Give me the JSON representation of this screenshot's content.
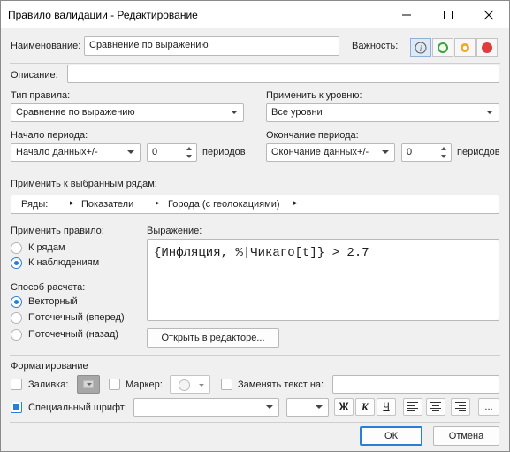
{
  "window": {
    "title": "Правило валидации - Редактирование"
  },
  "name": {
    "label": "Наименование:",
    "value": "Сравнение по выражению"
  },
  "severity": {
    "label": "Важность:",
    "levels": [
      "info-icon",
      "ring-green-icon",
      "ring-orange-icon",
      "dot-red-icon"
    ]
  },
  "description": {
    "label": "Описание:",
    "value": ""
  },
  "rule_type": {
    "label": "Тип правила:",
    "value": "Сравнение по выражению"
  },
  "apply_level": {
    "label": "Применить к уровню:",
    "value": "Все уровни"
  },
  "period_start": {
    "label": "Начало периода:",
    "combo": "Начало данных+/-",
    "num": "0",
    "unit": "периодов"
  },
  "period_end": {
    "label": "Окончание периода:",
    "combo": "Окончание данных+/-",
    "num": "0",
    "unit": "периодов"
  },
  "rows": {
    "label": "Применить к выбранным рядам:",
    "crumbs": [
      "Ряды:",
      "Показатели",
      "Города (с геолокациями)"
    ]
  },
  "apply_rule": {
    "label": "Применить правило:",
    "options": [
      "К рядам",
      "К наблюдениям"
    ],
    "selected": 1
  },
  "calc_method": {
    "label": "Способ расчета:",
    "options": [
      "Векторный",
      "Поточечный (вперед)",
      "Поточечный (назад)"
    ],
    "selected": 0
  },
  "expression": {
    "label": "Выражение:",
    "value": "{Инфляция, %|Чикаго[t]} > 2.7",
    "open_editor": "Открыть в редакторе..."
  },
  "formatting": {
    "label": "Форматирование",
    "fill_label": "Заливка:",
    "marker_label": "Маркер:",
    "replace_label": "Заменять текст на:",
    "replace_value": "",
    "special_font_label": "Специальный шрифт:",
    "font_value": "",
    "size_value": "",
    "bold": "Ж",
    "italic": "К",
    "underline": "Ч",
    "more": "..."
  },
  "footer": {
    "ok": "ОК",
    "cancel": "Отмена"
  }
}
